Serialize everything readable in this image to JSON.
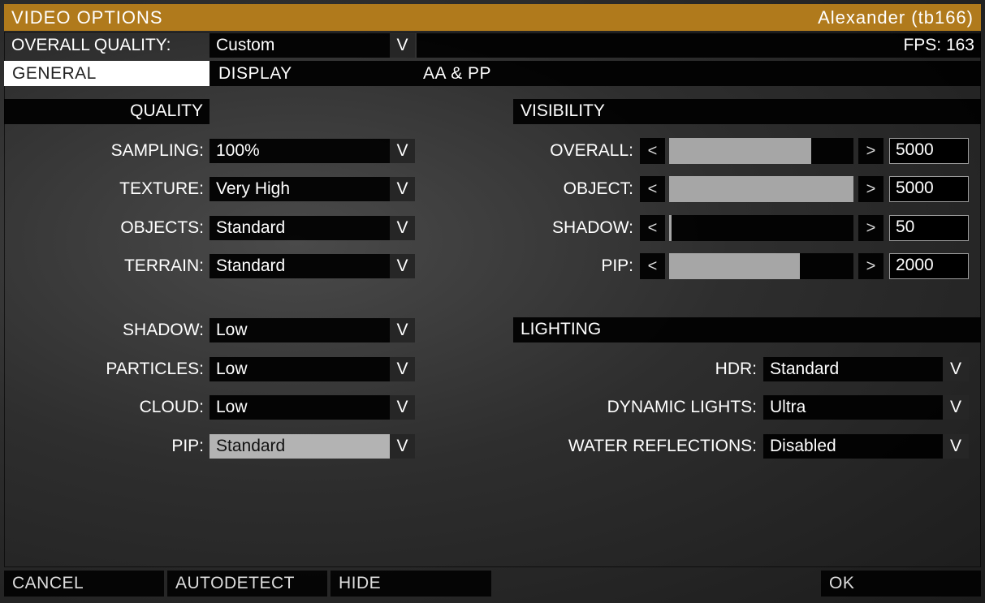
{
  "window": {
    "title": "VIDEO OPTIONS",
    "user": "Alexander (tb166)"
  },
  "header": {
    "overall_label": "OVERALL QUALITY:",
    "overall_value": "Custom",
    "dropdown_glyph": "V",
    "fps": "FPS: 163"
  },
  "tabs": [
    {
      "label": "GENERAL",
      "active": true
    },
    {
      "label": "DISPLAY",
      "active": false
    },
    {
      "label": "AA & PP",
      "active": false
    }
  ],
  "quality": {
    "heading": "QUALITY",
    "items": [
      {
        "label": "SAMPLING:",
        "value": "100%"
      },
      {
        "label": "TEXTURE:",
        "value": "Very High"
      },
      {
        "label": "OBJECTS:",
        "value": "Standard"
      },
      {
        "label": "TERRAIN:",
        "value": "Standard"
      },
      {
        "label": "SHADOW:",
        "value": "Low"
      },
      {
        "label": "PARTICLES:",
        "value": "Low"
      },
      {
        "label": "CLOUD:",
        "value": "Low"
      },
      {
        "label": "PIP:",
        "value": "Standard"
      }
    ]
  },
  "visibility": {
    "heading": "VISIBILITY",
    "left_arrow": "<",
    "right_arrow": ">",
    "sliders": [
      {
        "label": "OVERALL:",
        "value": "5000",
        "fill": 0.77
      },
      {
        "label": "OBJECT:",
        "value": "5000",
        "fill": 1.0
      },
      {
        "label": "SHADOW:",
        "value": "50",
        "fill": 0.01
      },
      {
        "label": "PIP:",
        "value": "2000",
        "fill": 0.71
      }
    ]
  },
  "lighting": {
    "heading": "LIGHTING",
    "items": [
      {
        "label": "HDR:",
        "value": "Standard"
      },
      {
        "label": "DYNAMIC LIGHTS:",
        "value": "Ultra"
      },
      {
        "label": "WATER REFLECTIONS:",
        "value": "Disabled"
      }
    ]
  },
  "footer": {
    "cancel": "CANCEL",
    "autodetect": "AUTODETECT",
    "hide": "HIDE",
    "ok": "OK"
  },
  "colors": {
    "title_bar": "#b07a1c",
    "active_tab": "#ffffff",
    "slider_fill": "#a6a6a6",
    "selected_value": "#b3b3b3"
  }
}
